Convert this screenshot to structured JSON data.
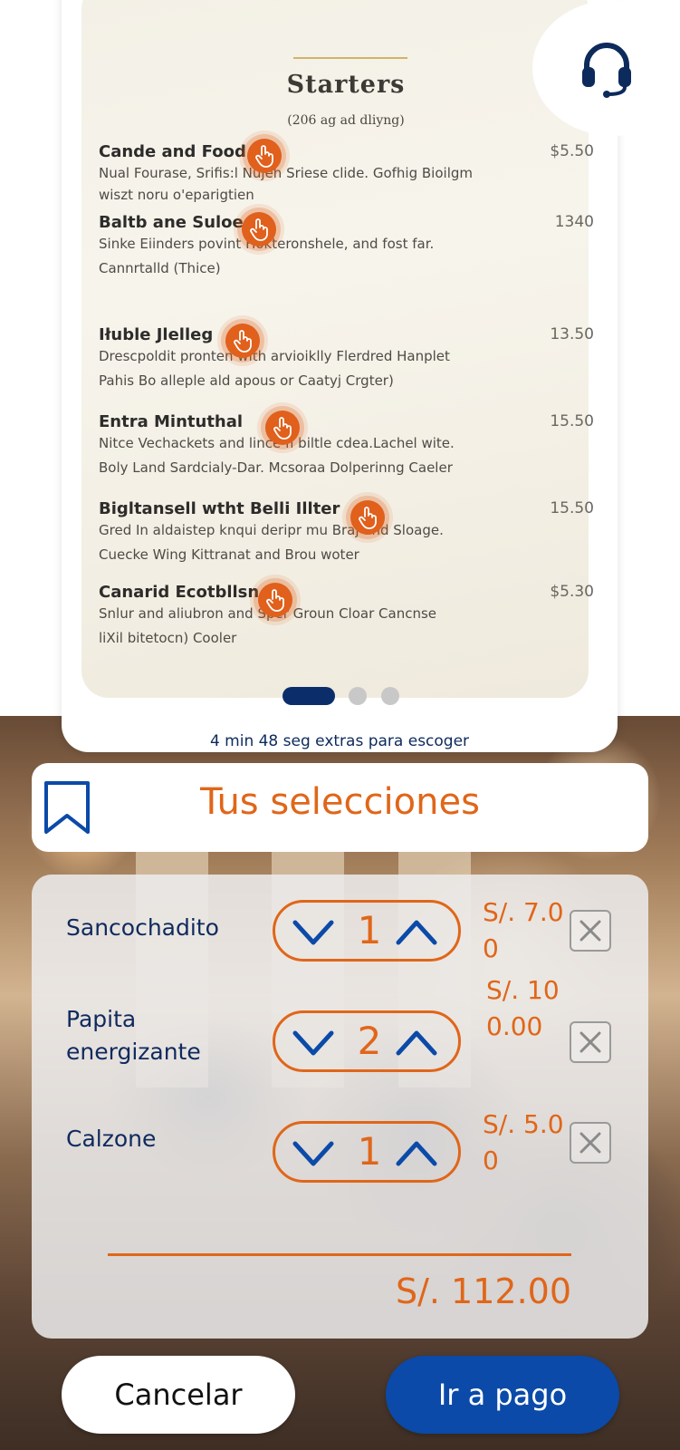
{
  "menu": {
    "title": "Starters",
    "subtitle": "(206 ag ad dliyng)",
    "items": [
      {
        "name": "Cande and Food",
        "price": "$5.50",
        "desc": [
          "Nual Fourase, Srifis:l Nujeh Sriese clide. Gofhig Bioilgm",
          "wiszt noru o'eparigtien"
        ]
      },
      {
        "name": "Baltb ane Suloe",
        "price": "1340",
        "desc": [
          "Sinke Eiinders povint Hokteronshele, and fost far.",
          "Cannrtalld (Thice)"
        ]
      },
      {
        "name": "Iłuble Jlelleg",
        "price": "13.50",
        "desc": [
          "Drescpoldit pronten with arvioiklly Flerdred Hanplet",
          "Pahis Bo alleple ald apous or Caatyj Crgter)"
        ]
      },
      {
        "name": "Entra Mintuthal",
        "price": "15.50",
        "desc": [
          "Nitce Vechackets and lince fi biltle cdea.Lachel wite.",
          "Boly Land Sardcialy-Dar. Mcsoraa Dolperinng Caeler"
        ]
      },
      {
        "name": "Bigltansell wtht Belli Illter",
        "price": "15.50",
        "desc": [
          "Gred In aldaistep knqui deripr mu Braj and Sloage.",
          "Cuecke Wing Kittranat and Brou woter"
        ]
      },
      {
        "name": "Canarid Ecotbllsn",
        "price": "$5.30",
        "desc": [
          "Snlur and aliubron and Sper Groun Cloar Cancnse",
          "liXil bitetocn) Cooler"
        ]
      }
    ],
    "carousel": {
      "pages": 3,
      "active_page": 1
    }
  },
  "timer_text": "4 min 48 seg extras para escoger",
  "selections": {
    "title": "Tus selecciones",
    "items": [
      {
        "name": "Sancochadito",
        "qty": "1",
        "price": "S/. 7.00"
      },
      {
        "name": "Papita energizante",
        "qty": "2",
        "price": "S/. 100.00"
      },
      {
        "name": "Calzone",
        "qty": "1",
        "price": "S/. 5.00"
      }
    ],
    "total": "S/. 112.00"
  },
  "buttons": {
    "cancel": "Cancelar",
    "pay": "Ir a pago"
  },
  "icons": {
    "support": "headset-icon",
    "bookmark": "bookmark-icon",
    "tap": "tap-hand-icon",
    "decrease": "chevron-down-icon",
    "increase": "chevron-up-icon",
    "remove": "close-icon"
  },
  "colors": {
    "accent": "#e06619",
    "navy": "#0d2a5c",
    "pay_button": "#0b4aa8"
  }
}
